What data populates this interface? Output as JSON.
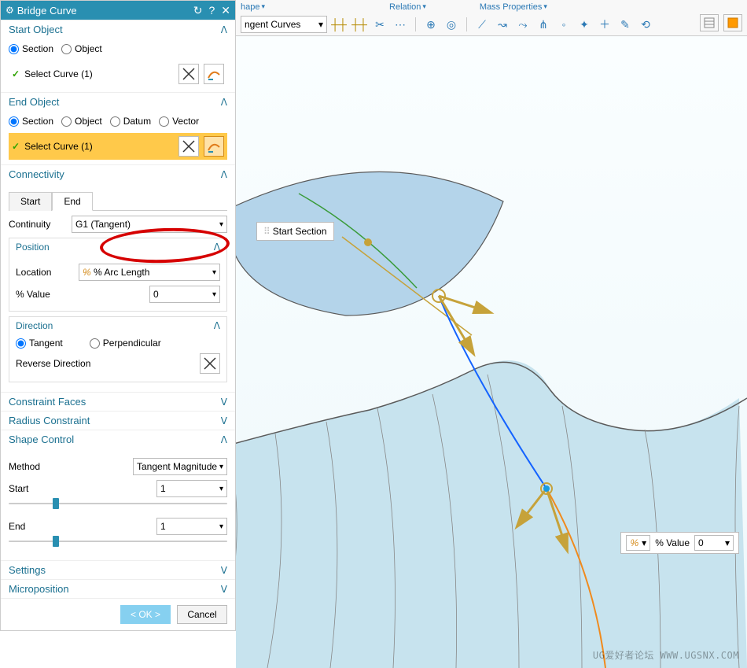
{
  "dialog": {
    "title": "Bridge Curve",
    "start_object": {
      "header": "Start Object",
      "opt_section": "Section",
      "opt_object": "Object",
      "select_curve": "Select Curve (1)"
    },
    "end_object": {
      "header": "End Object",
      "opt_section": "Section",
      "opt_object": "Object",
      "opt_datum": "Datum",
      "opt_vector": "Vector",
      "select_curve": "Select Curve (1)"
    },
    "connectivity": {
      "header": "Connectivity",
      "tab_start": "Start",
      "tab_end": "End",
      "continuity_label": "Continuity",
      "continuity_value": "G1 (Tangent)",
      "position": {
        "header": "Position",
        "location_label": "Location",
        "location_value": "% Arc Length",
        "percent_value_label": "% Value",
        "percent_value": "0"
      },
      "direction": {
        "header": "Direction",
        "opt_tangent": "Tangent",
        "opt_perp": "Perpendicular",
        "reverse": "Reverse Direction"
      }
    },
    "constraint_faces": "Constraint Faces",
    "radius_constraint": "Radius Constraint",
    "shape_control": {
      "header": "Shape Control",
      "method_label": "Method",
      "method_value": "Tangent Magnitude",
      "start_label": "Start",
      "start_value": "1",
      "end_label": "End",
      "end_value": "1"
    },
    "settings": "Settings",
    "microposition": "Microposition",
    "ok": "< OK >",
    "cancel": "Cancel"
  },
  "toolbar": {
    "menu_shape": "hape",
    "menu_relation": "Relation",
    "menu_massprops": "Mass Properties",
    "combo_value": "ngent Curves"
  },
  "viewport": {
    "start_section_label": "Start Section",
    "hud_percent_label": "% Value",
    "hud_percent_value": "0"
  },
  "watermark": "UG爱好者论坛  WWW.UGSNX.COM"
}
